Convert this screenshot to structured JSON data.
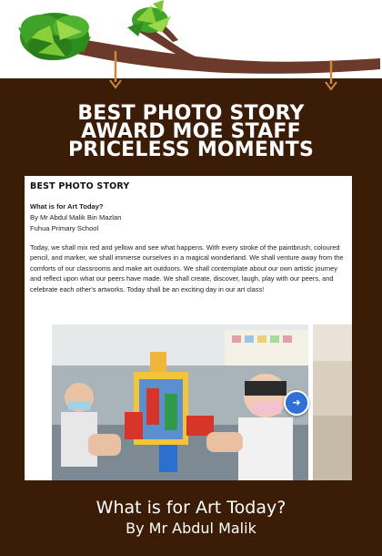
{
  "headline": {
    "line1": "BEST PHOTO STORY",
    "line2": "AWARD MOE STAFF",
    "line3": "PRICELESS MOMENTS"
  },
  "card": {
    "title": "BEST PHOTO STORY",
    "entry_title": "What is for Art Today?",
    "author": "By Mr Abdul Malik Bin Mazlan",
    "school": "Fuhua Primary School",
    "body": "Today, we shall mix red and yellow and see what happens. With every stroke of the paintbrush, coloured pencil, and marker, we shall immerse ourselves in a magical wonderland. We shall venture away from the comforts of our classrooms and make art outdoors. We shall contemplate about our own artistic journey and reflect upon what our peers have made. We shall create, discover, laugh, play with our peers, and celebrate each other's artworks. Today shall be an exciting day in our art class!",
    "next_icon": "arrow-right-icon",
    "next_glyph": "➜"
  },
  "caption": {
    "line1": "What is for Art Today?",
    "line2": "By Mr Abdul Malik"
  },
  "colors": {
    "board": "#3a1c07",
    "branch": "#6b3a2a",
    "leaf_dark": "#2e8b1e",
    "leaf_light": "#8ccf3a",
    "rope": "#c98a3a",
    "button": "#2f6fd8"
  }
}
